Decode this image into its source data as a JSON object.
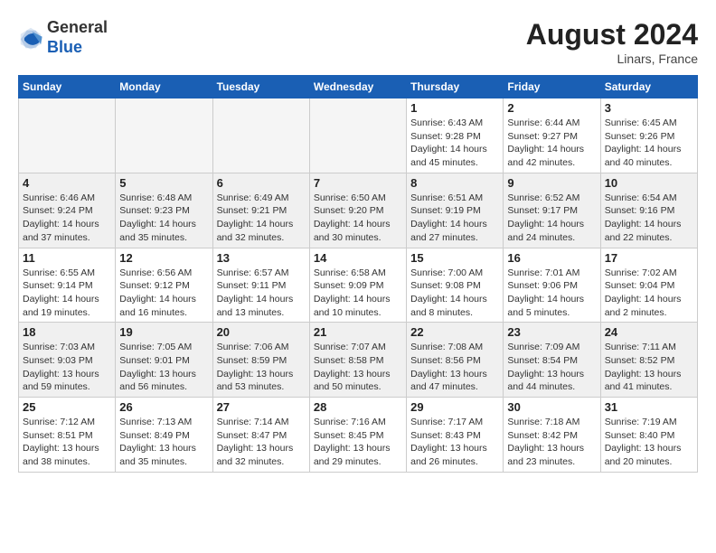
{
  "header": {
    "logo_line1": "General",
    "logo_line2": "Blue",
    "month_year": "August 2024",
    "location": "Linars, France"
  },
  "weekdays": [
    "Sunday",
    "Monday",
    "Tuesday",
    "Wednesday",
    "Thursday",
    "Friday",
    "Saturday"
  ],
  "weeks": [
    [
      {
        "day": "",
        "info": ""
      },
      {
        "day": "",
        "info": ""
      },
      {
        "day": "",
        "info": ""
      },
      {
        "day": "",
        "info": ""
      },
      {
        "day": "1",
        "info": "Sunrise: 6:43 AM\nSunset: 9:28 PM\nDaylight: 14 hours\nand 45 minutes."
      },
      {
        "day": "2",
        "info": "Sunrise: 6:44 AM\nSunset: 9:27 PM\nDaylight: 14 hours\nand 42 minutes."
      },
      {
        "day": "3",
        "info": "Sunrise: 6:45 AM\nSunset: 9:26 PM\nDaylight: 14 hours\nand 40 minutes."
      }
    ],
    [
      {
        "day": "4",
        "info": "Sunrise: 6:46 AM\nSunset: 9:24 PM\nDaylight: 14 hours\nand 37 minutes."
      },
      {
        "day": "5",
        "info": "Sunrise: 6:48 AM\nSunset: 9:23 PM\nDaylight: 14 hours\nand 35 minutes."
      },
      {
        "day": "6",
        "info": "Sunrise: 6:49 AM\nSunset: 9:21 PM\nDaylight: 14 hours\nand 32 minutes."
      },
      {
        "day": "7",
        "info": "Sunrise: 6:50 AM\nSunset: 9:20 PM\nDaylight: 14 hours\nand 30 minutes."
      },
      {
        "day": "8",
        "info": "Sunrise: 6:51 AM\nSunset: 9:19 PM\nDaylight: 14 hours\nand 27 minutes."
      },
      {
        "day": "9",
        "info": "Sunrise: 6:52 AM\nSunset: 9:17 PM\nDaylight: 14 hours\nand 24 minutes."
      },
      {
        "day": "10",
        "info": "Sunrise: 6:54 AM\nSunset: 9:16 PM\nDaylight: 14 hours\nand 22 minutes."
      }
    ],
    [
      {
        "day": "11",
        "info": "Sunrise: 6:55 AM\nSunset: 9:14 PM\nDaylight: 14 hours\nand 19 minutes."
      },
      {
        "day": "12",
        "info": "Sunrise: 6:56 AM\nSunset: 9:12 PM\nDaylight: 14 hours\nand 16 minutes."
      },
      {
        "day": "13",
        "info": "Sunrise: 6:57 AM\nSunset: 9:11 PM\nDaylight: 14 hours\nand 13 minutes."
      },
      {
        "day": "14",
        "info": "Sunrise: 6:58 AM\nSunset: 9:09 PM\nDaylight: 14 hours\nand 10 minutes."
      },
      {
        "day": "15",
        "info": "Sunrise: 7:00 AM\nSunset: 9:08 PM\nDaylight: 14 hours\nand 8 minutes."
      },
      {
        "day": "16",
        "info": "Sunrise: 7:01 AM\nSunset: 9:06 PM\nDaylight: 14 hours\nand 5 minutes."
      },
      {
        "day": "17",
        "info": "Sunrise: 7:02 AM\nSunset: 9:04 PM\nDaylight: 14 hours\nand 2 minutes."
      }
    ],
    [
      {
        "day": "18",
        "info": "Sunrise: 7:03 AM\nSunset: 9:03 PM\nDaylight: 13 hours\nand 59 minutes."
      },
      {
        "day": "19",
        "info": "Sunrise: 7:05 AM\nSunset: 9:01 PM\nDaylight: 13 hours\nand 56 minutes."
      },
      {
        "day": "20",
        "info": "Sunrise: 7:06 AM\nSunset: 8:59 PM\nDaylight: 13 hours\nand 53 minutes."
      },
      {
        "day": "21",
        "info": "Sunrise: 7:07 AM\nSunset: 8:58 PM\nDaylight: 13 hours\nand 50 minutes."
      },
      {
        "day": "22",
        "info": "Sunrise: 7:08 AM\nSunset: 8:56 PM\nDaylight: 13 hours\nand 47 minutes."
      },
      {
        "day": "23",
        "info": "Sunrise: 7:09 AM\nSunset: 8:54 PM\nDaylight: 13 hours\nand 44 minutes."
      },
      {
        "day": "24",
        "info": "Sunrise: 7:11 AM\nSunset: 8:52 PM\nDaylight: 13 hours\nand 41 minutes."
      }
    ],
    [
      {
        "day": "25",
        "info": "Sunrise: 7:12 AM\nSunset: 8:51 PM\nDaylight: 13 hours\nand 38 minutes."
      },
      {
        "day": "26",
        "info": "Sunrise: 7:13 AM\nSunset: 8:49 PM\nDaylight: 13 hours\nand 35 minutes."
      },
      {
        "day": "27",
        "info": "Sunrise: 7:14 AM\nSunset: 8:47 PM\nDaylight: 13 hours\nand 32 minutes."
      },
      {
        "day": "28",
        "info": "Sunrise: 7:16 AM\nSunset: 8:45 PM\nDaylight: 13 hours\nand 29 minutes."
      },
      {
        "day": "29",
        "info": "Sunrise: 7:17 AM\nSunset: 8:43 PM\nDaylight: 13 hours\nand 26 minutes."
      },
      {
        "day": "30",
        "info": "Sunrise: 7:18 AM\nSunset: 8:42 PM\nDaylight: 13 hours\nand 23 minutes."
      },
      {
        "day": "31",
        "info": "Sunrise: 7:19 AM\nSunset: 8:40 PM\nDaylight: 13 hours\nand 20 minutes."
      }
    ]
  ]
}
